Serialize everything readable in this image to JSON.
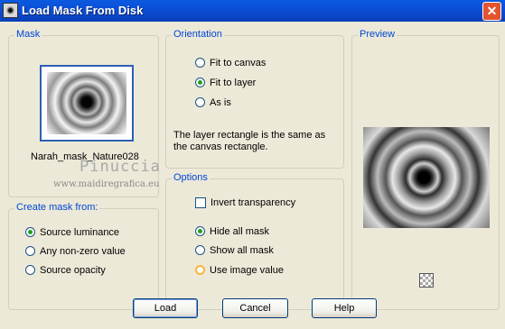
{
  "window": {
    "title": "Load Mask From Disk",
    "close_glyph": "✕"
  },
  "mask": {
    "legend": "Mask",
    "file_name": "Narah_mask_Nature028"
  },
  "watermark": {
    "line1": "Pinuccia",
    "line2": "www.maidiregrafica.eu"
  },
  "create_mask_from": {
    "legend": "Create mask from:",
    "options": [
      "Source luminance",
      "Any non-zero value",
      "Source opacity"
    ],
    "selected": "Source luminance"
  },
  "orientation": {
    "legend": "Orientation",
    "options": [
      "Fit to canvas",
      "Fit to layer",
      "As is"
    ],
    "selected": "Fit to layer",
    "description": "The layer rectangle is the same as the canvas rectangle."
  },
  "options": {
    "legend": "Options",
    "invert_label": "Invert transparency",
    "invert_checked": false,
    "mode_options": [
      "Hide all mask",
      "Show all mask",
      "Use image value"
    ],
    "selected": "Hide all mask",
    "hot": "Use image value"
  },
  "preview": {
    "legend": "Preview",
    "transparency_icon": "checkerboard-icon"
  },
  "buttons": {
    "load": "Load",
    "cancel": "Cancel",
    "help": "Help"
  }
}
